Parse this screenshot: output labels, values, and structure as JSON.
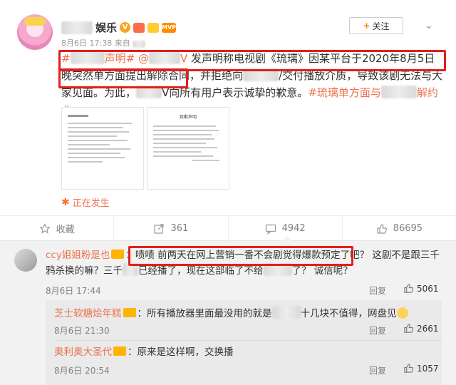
{
  "post": {
    "author_suffix": "娱乐",
    "badge_text": "MVP",
    "date": "8月6日 17:38",
    "source_prefix": "来自",
    "follow_label": "关注",
    "text_pre": "#",
    "text_seg1": "声明#",
    "text_at": "@",
    "text_seg2": "V",
    "text_main1": " 发声明称电视剧《琉璃》因某平台于2020年8月5日晚突然单方面提出解除合同，并拒绝向",
    "text_main2": "/交付播放介质，导致该剧无法与大家见面。为此，",
    "text_main3": "V向所有用户表示诚挚的歉意。",
    "text_tag_start": "#琉璃单方面与",
    "text_tag_end": "解约#",
    "doc1_title": "",
    "doc2_title": "致歉声明",
    "trending_label": "正在发生"
  },
  "actions": {
    "fav_label": "收藏",
    "repost_count": "361",
    "comment_count": "4942",
    "like_count": "86695"
  },
  "comments": [
    {
      "user": "ccy姐姐粉是也",
      "text_a": "啧啧 前两天在网上营销一番不会剧觉得爆款预定了吧？ 这剧不是跟三千鸦杀换的嘛？三千",
      "text_b": "已经播了，现在这部临了不给",
      "text_c": "了？ 诚信呢？",
      "date": "8月6日 17:44",
      "reply_label": "回复",
      "likes": "5061"
    },
    {
      "user": "芝士软糖烩年糕",
      "text_a": "：所有播放器里面最没用的就是",
      "text_b": "十几块不值得，网盘见",
      "date": "8月6日 21:30",
      "reply_label": "回复",
      "likes": "2661"
    },
    {
      "user": "奥利奥大圣代",
      "text_a": "：原来是这样啊，交换播",
      "date": "8月6日 20:54",
      "reply_label": "回复",
      "likes": "1057"
    }
  ],
  "colors": {
    "accent": "#eb7350",
    "highlight": "#e0201b",
    "follow_plus": "#ff8200"
  }
}
